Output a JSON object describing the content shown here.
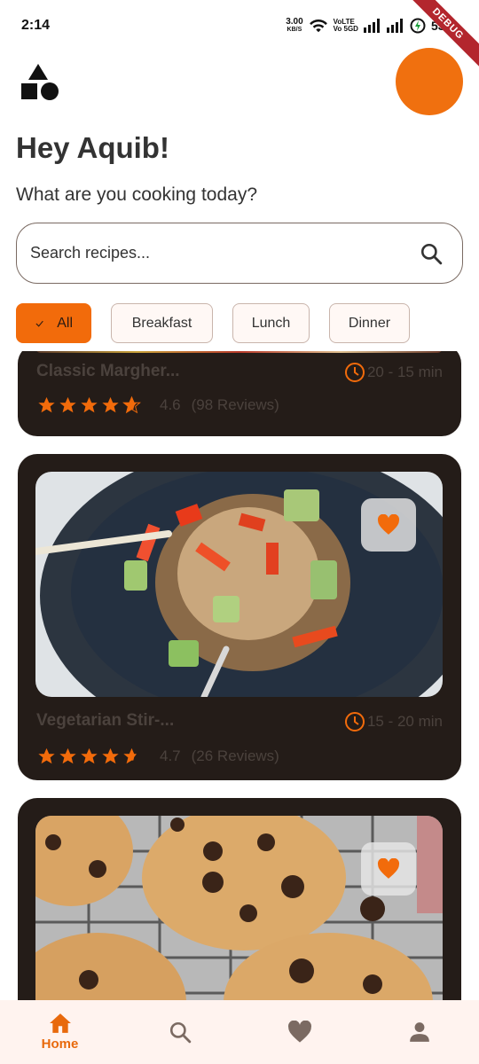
{
  "status_bar": {
    "time": "2:14",
    "net_speed_value": "3.00",
    "net_speed_unit": "KB/S",
    "volte_line1": "VoLTE",
    "volte_line2": "Vo 5GD",
    "battery": "53%",
    "debug_label": "DEBUG"
  },
  "header": {
    "greeting": "Hey Aquib!",
    "subtitle": "What are you cooking today?"
  },
  "search": {
    "placeholder": "Search recipes..."
  },
  "filters": {
    "chips": [
      {
        "label": "All",
        "selected": true
      },
      {
        "label": "Breakfast",
        "selected": false
      },
      {
        "label": "Lunch",
        "selected": false
      },
      {
        "label": "Dinner",
        "selected": false
      }
    ]
  },
  "recipes": [
    {
      "title": "Classic Margher...",
      "time": "20 - 15 min",
      "rating": "4.6",
      "reviews": "(98 Reviews)",
      "stars": 4.5
    },
    {
      "title": "Vegetarian Stir-...",
      "time": "15 - 20 min",
      "rating": "4.7",
      "reviews": "(26 Reviews)",
      "stars": 4.5
    },
    {
      "title": "",
      "time": "",
      "rating": "",
      "reviews": "",
      "stars": 0
    }
  ],
  "bottom_nav": {
    "home_label": "Home"
  },
  "colors": {
    "accent": "#f26b0b",
    "card_bg": "#241c18",
    "nav_bg": "#fff3ef"
  }
}
